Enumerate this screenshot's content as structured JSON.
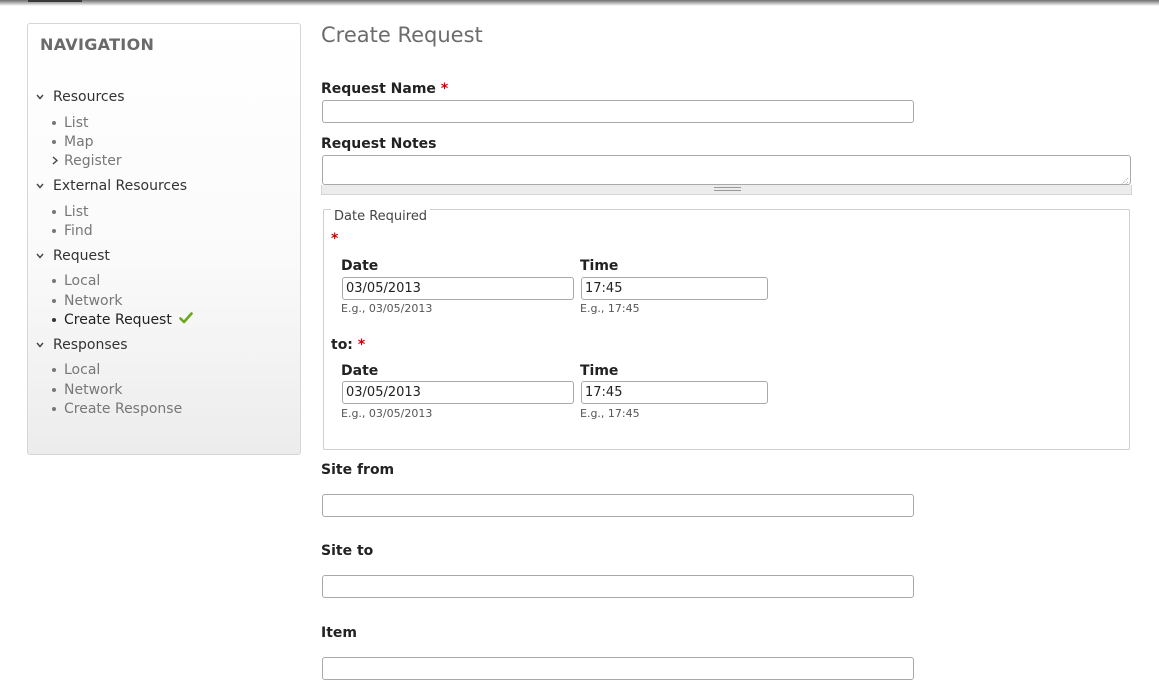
{
  "navigation": {
    "title": "NAVIGATION",
    "groups": [
      {
        "label": "Resources",
        "items": [
          {
            "label": "List"
          },
          {
            "label": "Map"
          },
          {
            "label": "Register"
          }
        ]
      },
      {
        "label": "External Resources",
        "items": [
          {
            "label": "List"
          },
          {
            "label": "Find"
          }
        ]
      },
      {
        "label": "Request",
        "items": [
          {
            "label": "Local"
          },
          {
            "label": "Network"
          },
          {
            "label": "Create Request"
          }
        ]
      },
      {
        "label": "Responses",
        "items": [
          {
            "label": "Local"
          },
          {
            "label": "Network"
          },
          {
            "label": "Create Response"
          }
        ]
      }
    ]
  },
  "page": {
    "title": "Create Request"
  },
  "form": {
    "request_name": {
      "label": "Request Name",
      "required_mark": "*",
      "value": ""
    },
    "request_notes": {
      "label": "Request Notes",
      "value": ""
    },
    "date_required": {
      "legend": "Date Required",
      "required_mark": "*",
      "from": {
        "date_label": "Date",
        "date_value": "03/05/2013",
        "date_hint": "E.g., 03/05/2013",
        "time_label": "Time",
        "time_value": "17:45",
        "time_hint": "E.g., 17:45"
      },
      "to_label": "to:",
      "to_required_mark": "*",
      "to": {
        "date_label": "Date",
        "date_value": "03/05/2013",
        "date_hint": "E.g., 03/05/2013",
        "time_label": "Time",
        "time_value": "17:45",
        "time_hint": "E.g., 17:45"
      }
    },
    "site_from": {
      "label": "Site from",
      "value": ""
    },
    "site_to": {
      "label": "Site to",
      "value": ""
    },
    "item": {
      "label": "Item",
      "value": ""
    }
  },
  "colors": {
    "required": "#cc0000",
    "check": "#6aa81a",
    "title": "#6c6c6c"
  }
}
